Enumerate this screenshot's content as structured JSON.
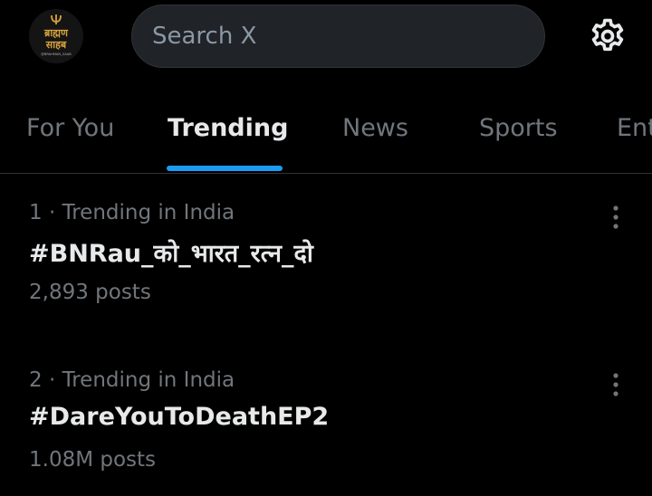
{
  "header": {
    "avatar_logo": {
      "line1": "ब्राह्मण",
      "line2": "साहब",
      "caption": "@BRAHMAN_SAAB"
    },
    "search_placeholder": "Search X",
    "settings_icon": "gear-icon"
  },
  "tabs": [
    {
      "label": "For You",
      "active": false
    },
    {
      "label": "Trending",
      "active": true
    },
    {
      "label": "News",
      "active": false
    },
    {
      "label": "Sports",
      "active": false
    },
    {
      "label": "Ent",
      "active": false
    }
  ],
  "trends": [
    {
      "meta": "1 · Trending in India",
      "title": "#BNRau_को_भारत_रत्न_दो",
      "count": "2,893 posts"
    },
    {
      "meta": "2 · Trending in India",
      "title": "#DareYouToDeathEP2",
      "count": "1.08M posts"
    }
  ],
  "colors": {
    "background": "#000000",
    "accent": "#1d9bf0",
    "text_primary": "#e7e9ea",
    "text_secondary": "#71767b",
    "logo_gold": "#d8a23b"
  }
}
